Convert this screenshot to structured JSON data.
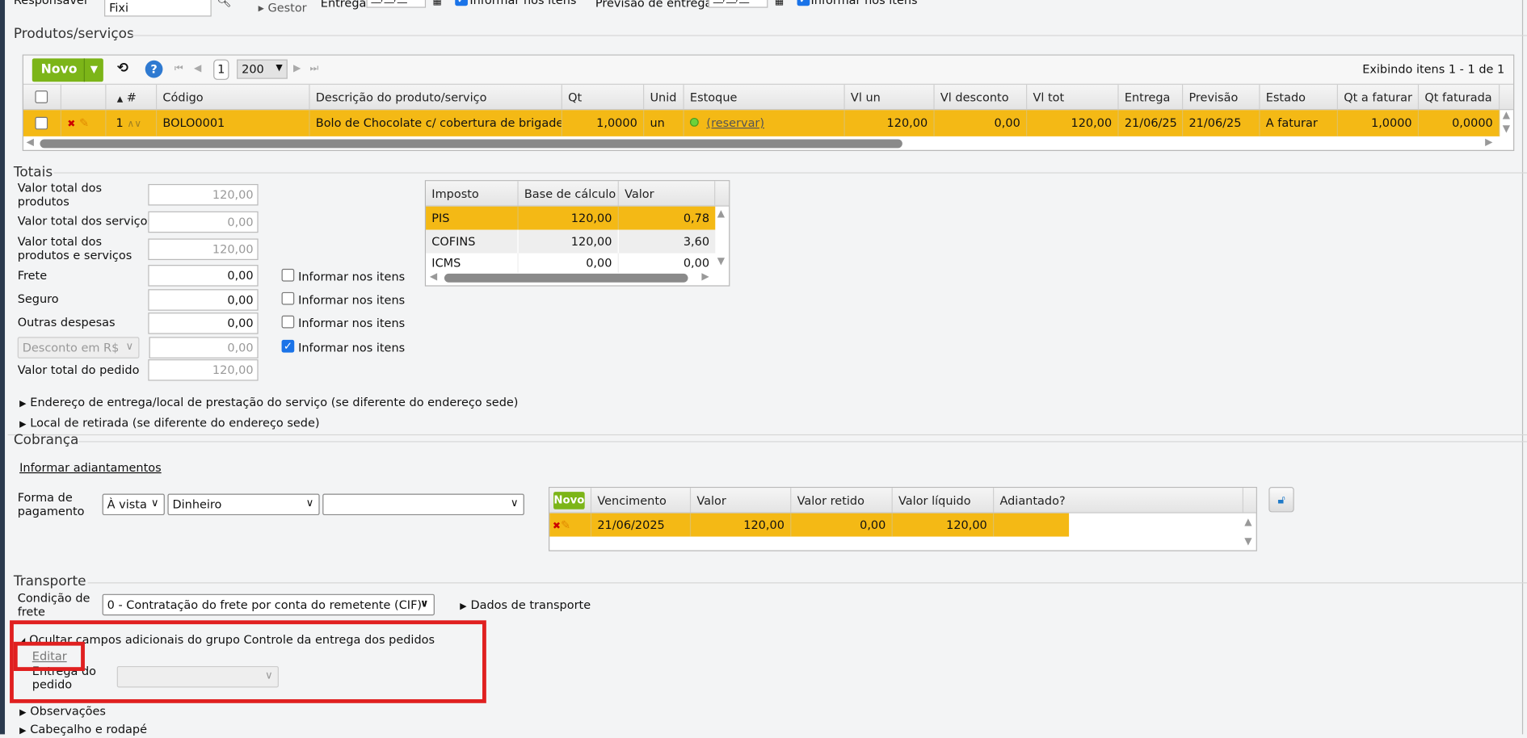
{
  "top": {
    "responsavel_label": "Responsável",
    "responsavel_value": "Fixi",
    "gestor_label": "Gestor",
    "entrega_label": "Entrega",
    "entrega_value": "__/__/__",
    "entrega_informar": "Informar nos itens",
    "previsao_label": "Previsão de entrega",
    "previsao_value": "__/__/__",
    "previsao_informar": "Informar nos itens"
  },
  "produtos": {
    "title": "Produtos/serviços",
    "novo_label": "Novo",
    "page": "1",
    "page_size": "200",
    "exibindo": "Exibindo itens 1 - 1 de 1",
    "columns": [
      "#",
      "Código",
      "Descrição do produto/serviço",
      "Qt",
      "Unid",
      "Estoque",
      "Vl un",
      "Vl desconto",
      "Vl tot",
      "Entrega",
      "Previsão",
      "Estado",
      "Qt a faturar",
      "Qt faturada"
    ],
    "rows": [
      {
        "num": "1",
        "codigo": "BOLO0001",
        "descricao": "Bolo de Chocolate c/ cobertura de brigade...",
        "qt": "1,0000",
        "unid": "un",
        "estoque": "(reservar)",
        "vl_un": "120,00",
        "vl_desconto": "0,00",
        "vl_tot": "120,00",
        "entrega": "21/06/25",
        "previsao": "21/06/25",
        "estado": "A faturar",
        "qt_a_faturar": "1,0000",
        "qt_faturada": "0,0000"
      }
    ]
  },
  "totais": {
    "title": "Totais",
    "produtos_label": "Valor total dos produtos",
    "produtos_value": "120,00",
    "servicos_label": "Valor total dos serviços",
    "servicos_value": "0,00",
    "prod_serv_label": "Valor total dos produtos e serviços",
    "prod_serv_value": "120,00",
    "frete_label": "Frete",
    "frete_value": "0,00",
    "seguro_label": "Seguro",
    "seguro_value": "0,00",
    "outras_label": "Outras despesas",
    "outras_value": "0,00",
    "desconto_select": "Desconto em R$",
    "desconto_value": "0,00",
    "pedido_label": "Valor total do pedido",
    "pedido_value": "120,00",
    "informar_label": "Informar nos itens",
    "informar_checked": [
      false,
      false,
      false,
      true
    ],
    "impostos": {
      "columns": [
        "Imposto",
        "Base de cálculo",
        "Valor"
      ],
      "rows": [
        {
          "imposto": "PIS",
          "base": "120,00",
          "valor": "0,78"
        },
        {
          "imposto": "COFINS",
          "base": "120,00",
          "valor": "3,60"
        },
        {
          "imposto": "ICMS",
          "base": "0,00",
          "valor": "0,00"
        }
      ]
    }
  },
  "expanders": {
    "endereco": "Endereço de entrega/local de prestação do serviço (se diferente do endereço sede)",
    "retirada": "Local de retirada (se diferente do endereço sede)"
  },
  "cobranca": {
    "title": "Cobrança",
    "adiantamentos_link": "Informar adiantamentos",
    "forma_label": "Forma de pagamento",
    "condicao": "À vista",
    "meio": "Dinheiro",
    "extra": "",
    "novo_label": "Novo",
    "columns": [
      "Vencimento",
      "Valor",
      "Valor retido",
      "Valor líquido",
      "Adiantado?"
    ],
    "rows": [
      {
        "vencimento": "21/06/2025",
        "valor": "120,00",
        "retido": "0,00",
        "liquido": "120,00",
        "adiantado": ""
      }
    ]
  },
  "transporte": {
    "title": "Transporte",
    "condicao_label": "Condição de frete",
    "condicao_value": "0 - Contratação do frete por conta do remetente (CIF)",
    "dados_link": "Dados de transporte",
    "ocultar": "Ocultar campos adicionais do grupo Controle da entrega dos pedidos",
    "editar": "Editar",
    "entrega_label": "Entrega do pedido",
    "entrega_value": ""
  },
  "footer": {
    "observacoes": "Observações",
    "cabecalho": "Cabeçalho e rodapé"
  },
  "colors": {
    "highlight": "#f4b915",
    "green": "#7cb518",
    "annotation": "#e02020"
  }
}
